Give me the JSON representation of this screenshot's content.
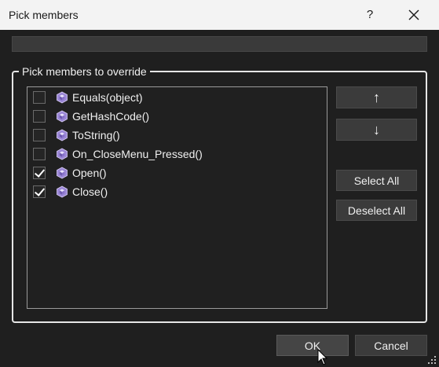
{
  "window": {
    "title": "Pick members",
    "help_label": "?",
    "close_icon": "close-icon"
  },
  "search": {
    "value": "",
    "placeholder": ""
  },
  "group": {
    "label": "Pick members to override",
    "members": [
      {
        "label": "Equals(object)",
        "checked": false,
        "icon": "method-cube-icon"
      },
      {
        "label": "GetHashCode()",
        "checked": false,
        "icon": "method-cube-icon"
      },
      {
        "label": "ToString()",
        "checked": false,
        "icon": "method-cube-icon"
      },
      {
        "label": "On_CloseMenu_Pressed()",
        "checked": false,
        "icon": "method-cube-icon"
      },
      {
        "label": "Open()",
        "checked": true,
        "icon": "method-cube-icon"
      },
      {
        "label": "Close()",
        "checked": true,
        "icon": "method-cube-icon"
      }
    ]
  },
  "buttons": {
    "move_up": "↑",
    "move_down": "↓",
    "select_all": "Select All",
    "deselect_all": "Deselect All",
    "ok": "OK",
    "cancel": "Cancel"
  },
  "colors": {
    "window_bg": "#1f1f1f",
    "titlebar_bg": "#f3f3f3",
    "icon_purple": "#9b87d6",
    "button_bg": "#3b3b3b"
  }
}
